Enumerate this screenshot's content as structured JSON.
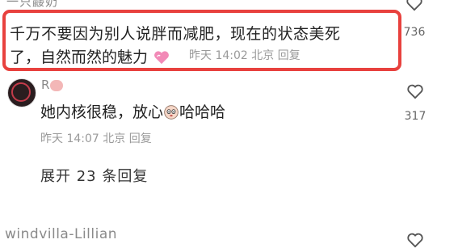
{
  "top_comment": {
    "username": "一只鼹奶",
    "text_line1": "千万不要因为别人说胖而减肥，现在的状态美死",
    "text_line2": "了，自然而然的魅力",
    "emoji": "heart-emoji",
    "meta": "昨天 14:02 北京 回复",
    "likes": "736",
    "highlight_color": "#e8413e"
  },
  "reply": {
    "username": "R",
    "text_before": "她内核很稳，放心",
    "emoji": "face-emoji",
    "text_after": "哈哈哈",
    "meta": "昨天 14:07 北京 回复",
    "likes": "317"
  },
  "expand_label": "展开 23 条回复",
  "next_comment": {
    "username": "windvilla-Lillian"
  }
}
